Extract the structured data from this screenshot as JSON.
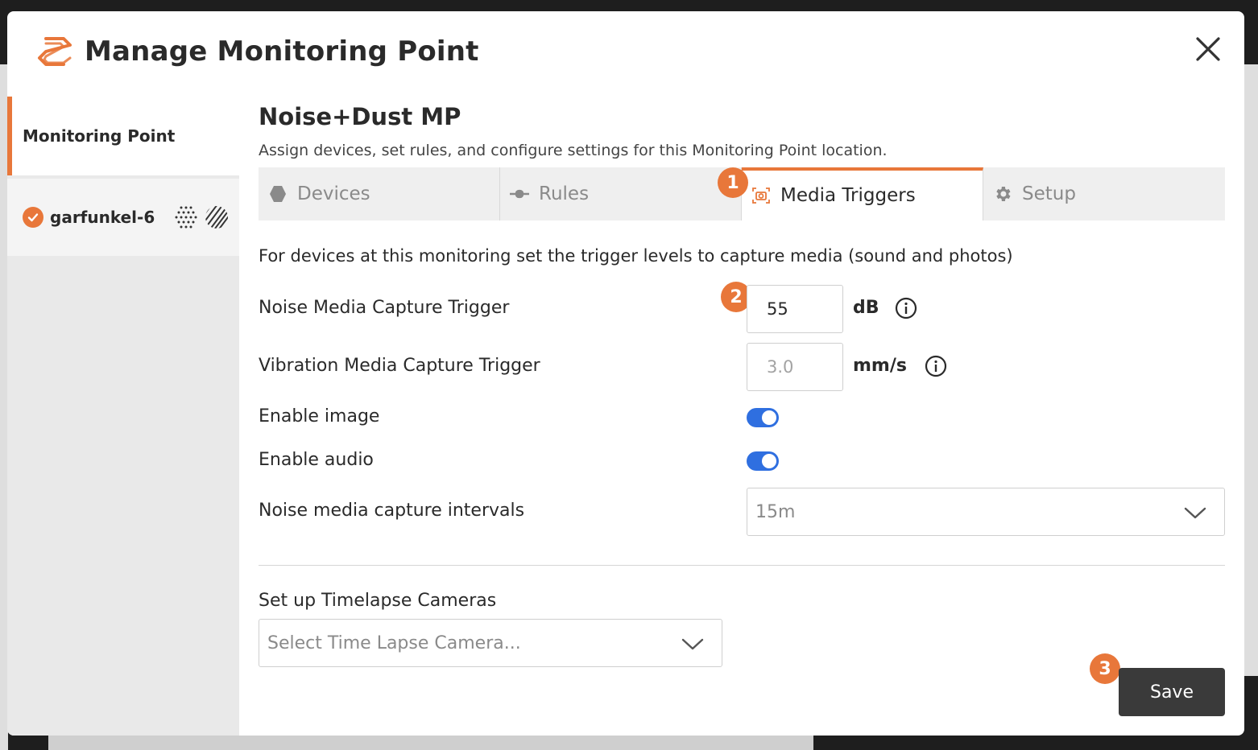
{
  "modal": {
    "title": "Manage Monitoring Point",
    "logo_icon": "brand-s-logo-icon",
    "close_icon": "close-icon",
    "accent_color": "#e8773a"
  },
  "sidebar": {
    "monitoring_point_label": "Monitoring Point",
    "device": {
      "name": "garfunkel-6",
      "status_icon": "check-circle-icon",
      "icons": [
        "noise-sensor-icon",
        "dust-sensor-icon"
      ]
    }
  },
  "main": {
    "mp_name": "Noise+Dust MP",
    "description": "Assign devices, set rules, and configure settings for this Monitoring Point location.",
    "tabs": [
      {
        "label": "Devices",
        "icon": "hexagon-icon",
        "active": false
      },
      {
        "label": "Rules",
        "icon": "rule-connector-icon",
        "active": false
      },
      {
        "label": "Media Triggers",
        "icon": "camera-focus-icon",
        "active": true
      },
      {
        "label": "Setup",
        "icon": "gear-icon",
        "active": false
      }
    ],
    "intro": "For devices at this monitoring set the trigger levels to capture media (sound and photos)",
    "noise_trigger": {
      "label": "Noise Media Capture Trigger",
      "value": "55",
      "unit": "dB"
    },
    "vibration_trigger": {
      "label": "Vibration Media Capture Trigger",
      "value": "",
      "placeholder": "3.0",
      "unit": "mm/s"
    },
    "enable_image": {
      "label": "Enable image",
      "enabled": true
    },
    "enable_audio": {
      "label": "Enable audio",
      "enabled": true
    },
    "capture_interval": {
      "label": "Noise media capture intervals",
      "value": "15m"
    },
    "timelapse": {
      "label": "Set up Timelapse Cameras",
      "placeholder": "Select Time Lapse Camera..."
    },
    "save_label": "Save"
  },
  "badges": {
    "one": "1",
    "two": "2",
    "three": "3"
  },
  "colors": {
    "toggle_on": "#2f6fe0",
    "save_bg": "#3a3a3a"
  }
}
